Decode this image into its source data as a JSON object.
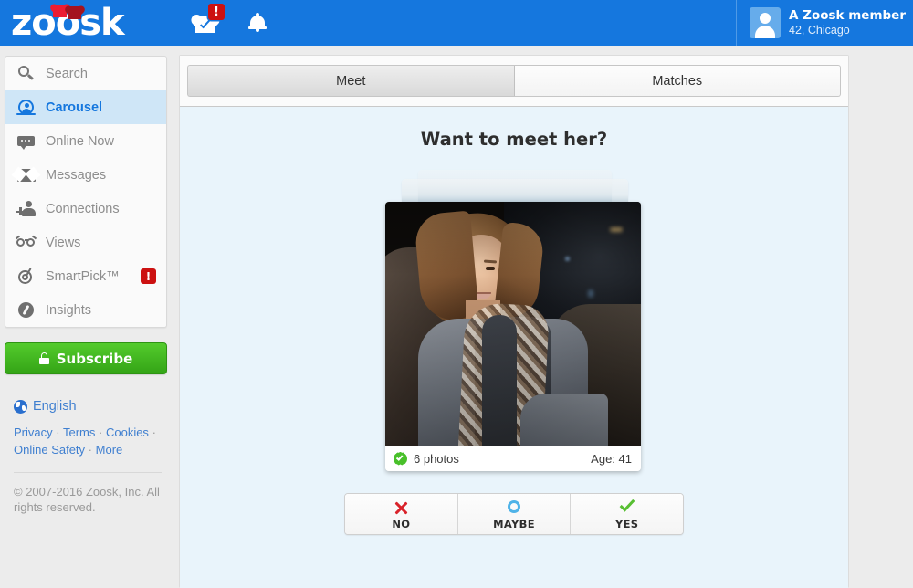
{
  "header": {
    "logo_text": "zoosk",
    "icons": [
      {
        "name": "matches-heart-check-icon",
        "badge": "!"
      },
      {
        "name": "notifications-bell-icon",
        "badge": ""
      }
    ],
    "user": {
      "name": "A Zoosk member",
      "meta": "42, Chicago",
      "avatar_icon": "user-avatar-placeholder-icon"
    }
  },
  "sidebar": {
    "items": [
      {
        "label": "Search",
        "icon": "search-icon",
        "active": false,
        "badge": ""
      },
      {
        "label": "Carousel",
        "icon": "carousel-icon",
        "active": true,
        "badge": ""
      },
      {
        "label": "Online Now",
        "icon": "chat-bubble-icon",
        "active": false,
        "badge": ""
      },
      {
        "label": "Messages",
        "icon": "envelope-icon",
        "active": false,
        "badge": ""
      },
      {
        "label": "Connections",
        "icon": "add-person-icon",
        "active": false,
        "badge": ""
      },
      {
        "label": "Views",
        "icon": "glasses-icon",
        "active": false,
        "badge": ""
      },
      {
        "label": "SmartPick™",
        "icon": "target-icon",
        "active": false,
        "badge": "!"
      },
      {
        "label": "Insights",
        "icon": "compass-icon",
        "active": false,
        "badge": ""
      }
    ],
    "subscribe_label": "Subscribe",
    "subscribe_icon": "lock-icon",
    "language_label": "English",
    "language_icon": "globe-icon",
    "footer_links": [
      "Privacy",
      "Terms",
      "Cookies",
      "Online Safety",
      "More"
    ],
    "footer_separator": "·",
    "copyright": "© 2007-2016 Zoosk, Inc. All rights reserved."
  },
  "main": {
    "tabs": [
      {
        "label": "Meet",
        "selected": true
      },
      {
        "label": "Matches",
        "selected": false
      }
    ],
    "headline": "Want to meet her?",
    "card": {
      "photo_count": "6 photos",
      "age": "Age: 41",
      "verified_icon": "verified-check-icon"
    },
    "actions": [
      {
        "label": "NO",
        "icon": "x-icon"
      },
      {
        "label": "MAYBE",
        "icon": "circle-icon"
      },
      {
        "label": "YES",
        "icon": "check-icon"
      }
    ]
  },
  "colors": {
    "header_blue": "#1577de",
    "accent_blue": "#1577de",
    "active_nav_bg": "#cfe6f7",
    "subscribe_green": "#49c02a",
    "badge_red": "#cc1111",
    "content_bg": "#e9f4fb",
    "no_red": "#d9232b",
    "maybe_blue": "#4fb3e8",
    "yes_green": "#58bf33",
    "link_blue": "#3f7fd0"
  }
}
